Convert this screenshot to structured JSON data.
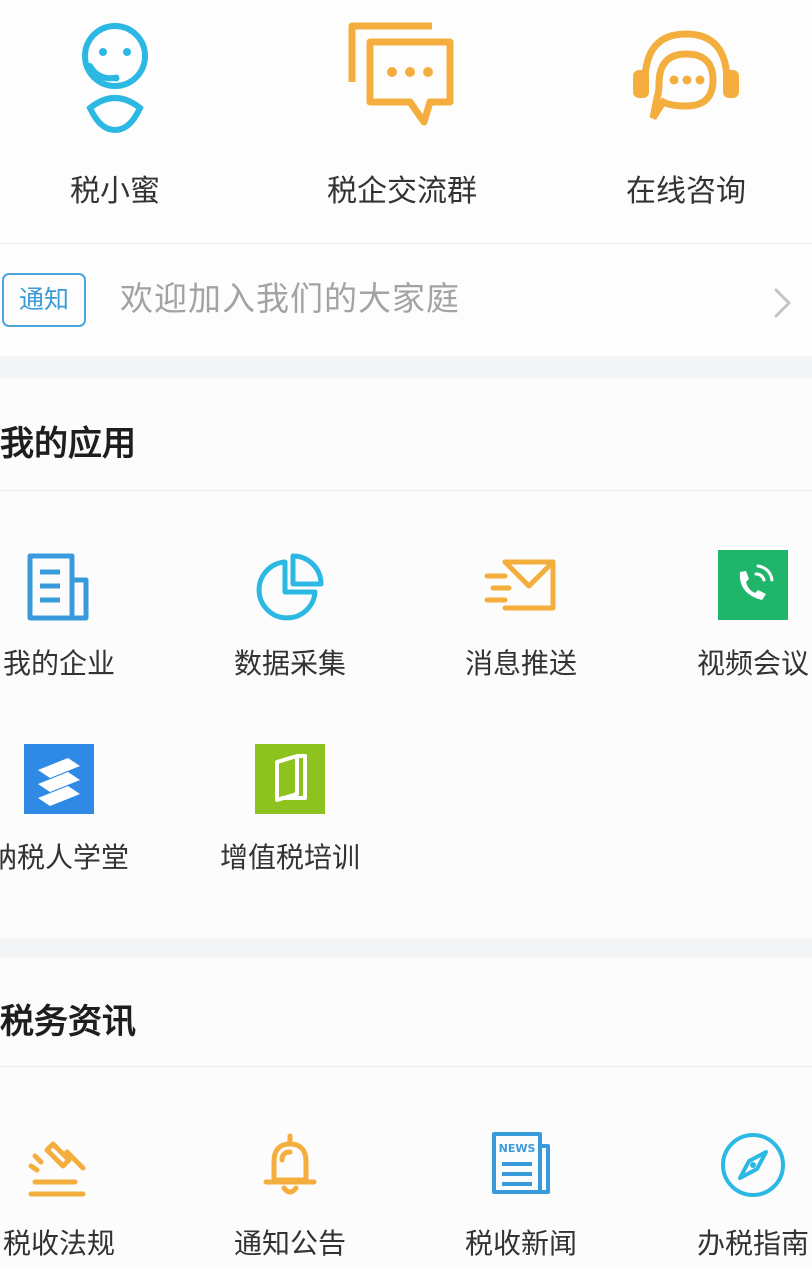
{
  "top_services": [
    {
      "label": "税小蜜",
      "icon": "robot-assistant-icon"
    },
    {
      "label": "税企交流群",
      "icon": "chat-group-icon"
    },
    {
      "label": "在线咨询",
      "icon": "headset-chat-icon"
    }
  ],
  "notice": {
    "badge": "通知",
    "text": "欢迎加入我们的大家庭",
    "arrow_icon": "chevron-right-icon"
  },
  "my_apps": {
    "title": "我的应用",
    "items": [
      {
        "label": "我的企业",
        "icon": "enterprise-document-icon"
      },
      {
        "label": "数据采集",
        "icon": "pie-chart-icon"
      },
      {
        "label": "消息推送",
        "icon": "send-mail-icon"
      },
      {
        "label": "视频会议",
        "icon": "video-call-icon"
      },
      {
        "label": "纳税人学堂",
        "icon": "school-logo-icon"
      },
      {
        "label": "增值税培训",
        "icon": "book-icon"
      }
    ]
  },
  "tax_news": {
    "title": "税务资讯",
    "items": [
      {
        "label": "税收法规",
        "icon": "gavel-icon"
      },
      {
        "label": "通知公告",
        "icon": "bell-icon"
      },
      {
        "label": "税收新闻",
        "icon": "newspaper-icon",
        "icon_text": "NEWS"
      },
      {
        "label": "办税指南",
        "icon": "compass-icon"
      }
    ]
  },
  "colors": {
    "cyan": "#2bb8e3",
    "orange": "#f3ae3e",
    "blue": "#3a9bdc",
    "green": "#1fb56b",
    "blue_tile": "#2f8ae6",
    "lime_tile": "#8ec21f"
  }
}
